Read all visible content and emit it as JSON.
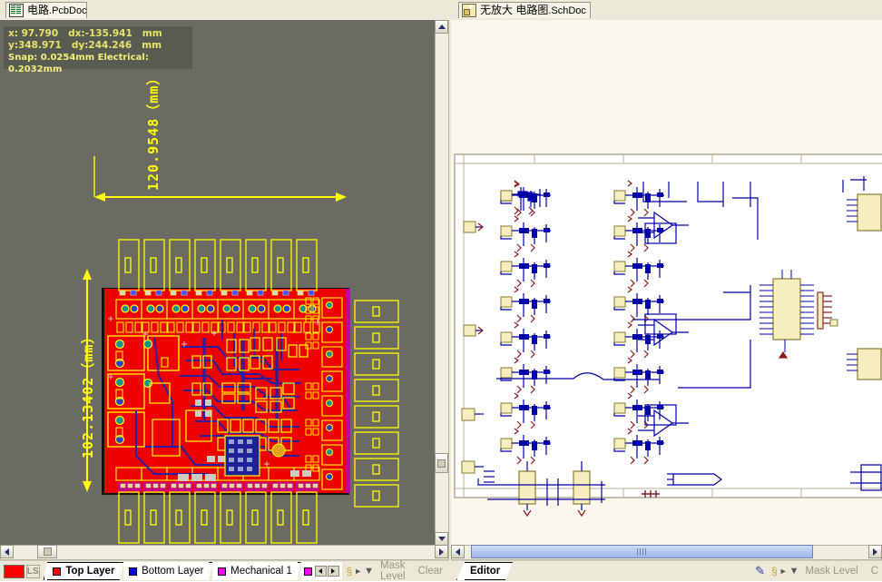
{
  "window": {
    "app": "Altium PCB / Schematic Editor",
    "background_color": "#ece9d8"
  },
  "tabs": [
    {
      "id": "pcb",
      "label": "电路",
      "suffix": ".PcbDoc",
      "icon": "pcb-document-icon",
      "active": true
    },
    {
      "id": "sch",
      "label": "无放大 电路图",
      "suffix": ".SchDoc",
      "icon": "schematic-document-icon",
      "active": true
    }
  ],
  "pcb_panel": {
    "canvas_bg": "#6b6b63",
    "status": {
      "x_label": "x: 97.790",
      "dx_label": "dx:-135.941",
      "unit1": "mm",
      "y_label": "y:348.971",
      "dy_label": "dy:244.246",
      "unit2": "mm",
      "snap_line": "Snap: 0.0254mm Electrical: 0.2032mm",
      "text_color": "#e8e46a",
      "box_color": "#575b52"
    },
    "dimensions": {
      "horizontal": "120.9548（mm）",
      "vertical": "102.13402（mm）",
      "color": "#ffff00"
    },
    "board": {
      "copper_color": "#ee0000",
      "silk_color": "#ffff00",
      "bottom_color": "#2020a0",
      "top_connectors": 8,
      "bottom_connectors": 8,
      "right_connectors": 8
    }
  },
  "sch_panel": {
    "sheet_bg": "#ffffff",
    "page_bg": "#fbf7ec",
    "wire_color": "#0000a8",
    "part_color": "#f7eec0",
    "pin_color": "#8b1a1a"
  },
  "pcb_statusbar": {
    "layer_swatch_color": "#ff0000",
    "ls_button": "LS",
    "tabs": [
      {
        "label": "Top Layer",
        "color": "#ff0000",
        "selected": true
      },
      {
        "label": "Bottom Layer",
        "color": "#0000ee",
        "selected": false
      },
      {
        "label": "Mechanical 1",
        "color": "#ff00ff",
        "selected": false
      }
    ],
    "extra_chip_color": "#ff00ff",
    "nav_prev_icon": "arrow-left-icon",
    "nav_next_icon": "arrow-right-icon",
    "drc_icon": "drc-icon",
    "play_icon": "play-icon",
    "filter_icon": "filter-icon",
    "mask_level": "Mask Level",
    "clear": "Clear"
  },
  "sch_statusbar": {
    "tabs": [
      {
        "label": "Editor",
        "selected": true
      }
    ],
    "pen_icon": "pen-icon",
    "drc_icon": "drc-icon",
    "play_icon": "play-icon",
    "filter_icon": "filter-icon",
    "mask_level": "Mask Level",
    "clear": "C"
  },
  "scrollbars": {
    "pcb_vertical": {
      "up_icon": "chevron-up-icon",
      "down_icon": "chevron-down-icon",
      "thumb_icon": "thumb-grip"
    },
    "pcb_horizontal": {
      "left_icon": "chevron-left-icon",
      "right_icon": "chevron-right-icon"
    },
    "sch_horizontal": {
      "left_icon": "chevron-left-icon",
      "right_icon": "chevron-right-icon"
    }
  }
}
